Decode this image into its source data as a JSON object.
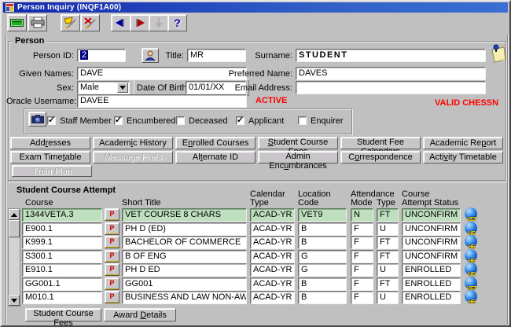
{
  "window": {
    "title": "Person Inquiry (INQF1A00)"
  },
  "icons": {
    "check": "✓",
    "help": "?"
  },
  "person": {
    "section_label": "Person",
    "person_id_label": "Person ID:",
    "person_id_value": "2",
    "title_label": "Title:",
    "title_value": "MR",
    "surname_label": "Surname:",
    "surname_value": "STUDENT",
    "given_names_label": "Given Names:",
    "given_names_value": "DAVE",
    "preferred_name_label": "Preferred Name:",
    "preferred_name_value": "DAVES",
    "sex_label": "Sex:",
    "sex_value": "Male",
    "dob_label": "Date Of Birth:",
    "dob_value": "01/01/XX",
    "email_label": "Email Address:",
    "email_value": "",
    "oracle_username_label": "Oracle Username:",
    "oracle_username_value": "DAVEE",
    "status_active": "ACTIVE",
    "status_chessn": "VALID CHESSN",
    "checkboxes": [
      {
        "label": "Staff Member",
        "checked": true
      },
      {
        "label": "Encumbered",
        "checked": true
      },
      {
        "label": "Deceased",
        "checked": false
      },
      {
        "label": "Applicant",
        "checked": true
      },
      {
        "label": "Enquirer",
        "checked": false
      }
    ]
  },
  "nav_buttons": {
    "row1": [
      {
        "label": "Addresses",
        "u": 3
      },
      {
        "label": "Academic History",
        "u": 6
      },
      {
        "label": "Enrolled Courses",
        "u": 1
      },
      {
        "label": "Student Course Fees",
        "u": 0
      },
      {
        "label": "Student Fee Calendars",
        "u": 12
      },
      {
        "label": "Academic Report",
        "u": 11
      }
    ],
    "row2": [
      {
        "label": "Exam Timetable",
        "u": 9
      },
      {
        "label": "Message Prefs",
        "u": -1,
        "disabled": true
      },
      {
        "label": "Alternate ID",
        "u": 2
      },
      {
        "label": "Admin Encumbrances",
        "u": 9
      },
      {
        "label": "Correspondence",
        "u": 1
      },
      {
        "label": "Activity Timetable",
        "u": 4
      }
    ],
    "row3": [
      {
        "label": "Train Plan",
        "u": -1,
        "disabled": true
      }
    ]
  },
  "course_attempt": {
    "section_label": "Student Course Attempt",
    "columns": {
      "course": "Course",
      "short_title": "Short Title",
      "calendar_1": "Calendar",
      "calendar_2": "Type",
      "location_1": "Location",
      "location_2": "Code",
      "attendance": "Attendance",
      "mode": "Mode",
      "type": "Type",
      "status_1": "Course",
      "status_2": "Attempt Status"
    },
    "rows": [
      {
        "course": "1344VETA.3",
        "short_title": "VET COURSE 8 CHARS",
        "calendar_type": "ACAD-YR",
        "location_code": "VET9",
        "mode": "N",
        "type": "FT",
        "status": "UNCONFIRM",
        "sector": "VET"
      },
      {
        "course": "E900.1",
        "short_title": "PH D (ED)",
        "calendar_type": "ACAD-YR",
        "location_code": "B",
        "mode": "F",
        "type": "U",
        "status": "UNCONFIRM",
        "sector": "HE"
      },
      {
        "course": "K999.1",
        "short_title": "BACHELOR OF COMMERCE",
        "calendar_type": "ACAD-YR",
        "location_code": "B",
        "mode": "F",
        "type": "FT",
        "status": "UNCONFIRM",
        "sector": "HE"
      },
      {
        "course": "S300.1",
        "short_title": "B OF ENG",
        "calendar_type": "ACAD-YR",
        "location_code": "G",
        "mode": "F",
        "type": "FT",
        "status": "UNCONFIRM",
        "sector": "HE"
      },
      {
        "course": "E910.1",
        "short_title": "PH D ED",
        "calendar_type": "ACAD-YR",
        "location_code": "G",
        "mode": "F",
        "type": "U",
        "status": "ENROLLED",
        "sector": "HE"
      },
      {
        "course": "GG001.1",
        "short_title": "GG001",
        "calendar_type": "ACAD-YR",
        "location_code": "B",
        "mode": "F",
        "type": "FT",
        "status": "ENROLLED",
        "sector": "VET"
      },
      {
        "course": "M010.1",
        "short_title": "BUSINESS AND LAW NON-AWARD",
        "calendar_type": "ACAD-YR",
        "location_code": "B",
        "mode": "F",
        "type": "U",
        "status": "ENROLLED",
        "sector": "HE"
      }
    ],
    "footer_buttons": [
      {
        "label": "Student Course Fees",
        "u": 15
      },
      {
        "label": "Award Details",
        "u": 6
      }
    ]
  },
  "colors": {
    "titlebar": "#1227ad",
    "highlight_row": "#bfe0bf",
    "status_red": "#ff0000"
  }
}
